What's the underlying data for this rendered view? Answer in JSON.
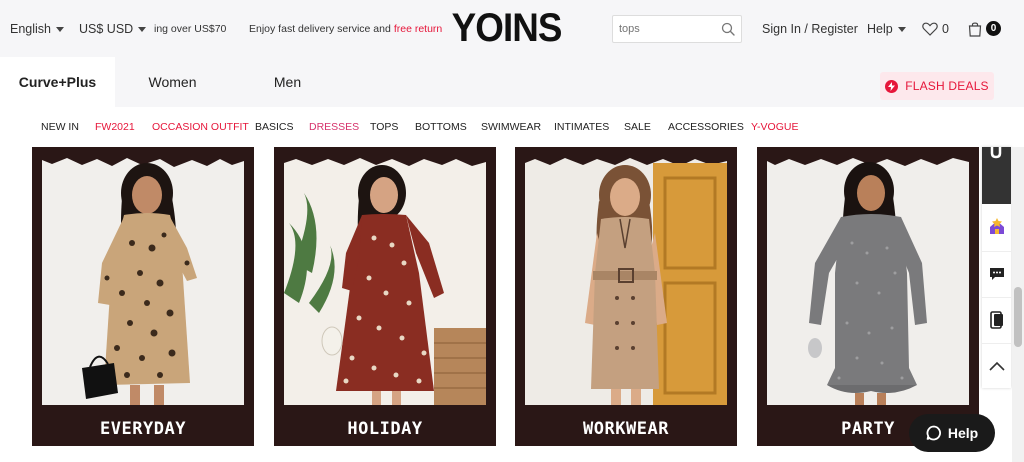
{
  "topbar": {
    "language": "English",
    "currency": "US$ USD",
    "shipping_promo": "ing over US$70",
    "delivery_promo": "Enjoy fast delivery service and",
    "return_promo": "free return",
    "logo": "YOINS",
    "search_placeholder": "tops",
    "signin": "Sign In / Register",
    "help": "Help",
    "wishlist_count": "0",
    "cart_count": "0"
  },
  "nav": {
    "tabs": [
      "Curve+Plus",
      "Women",
      "Men"
    ],
    "active": "Curve+Plus",
    "flash_deals": "FLASH DEALS"
  },
  "categories": [
    "NEW IN",
    "FW2021",
    "OCCASION OUTFIT",
    "BASICS",
    "DRESSES",
    "TOPS",
    "BOTTOMS",
    "SWIMWEAR",
    "INTIMATES",
    "SALE",
    "ACCESSORIES",
    "Y-VOGUE"
  ],
  "products": [
    {
      "label": "EVERYDAY",
      "dress_color": "#c9a57a",
      "pattern_color": "#3b2a1c"
    },
    {
      "label": "HOLIDAY",
      "dress_color": "#8a2d22",
      "pattern_color": "#e8d8c4"
    },
    {
      "label": "WORKWEAR",
      "dress_color": "#c4a080",
      "pattern_color": "#5a4030"
    },
    {
      "label": "PARTY",
      "dress_color": "#7a7a7c",
      "pattern_color": "#a8a8aa"
    }
  ],
  "help_button": "Help",
  "colors": {
    "accent_red": "#e6163a",
    "card_frame": "#2a1716",
    "topbar_bg": "#f6f6f8"
  }
}
